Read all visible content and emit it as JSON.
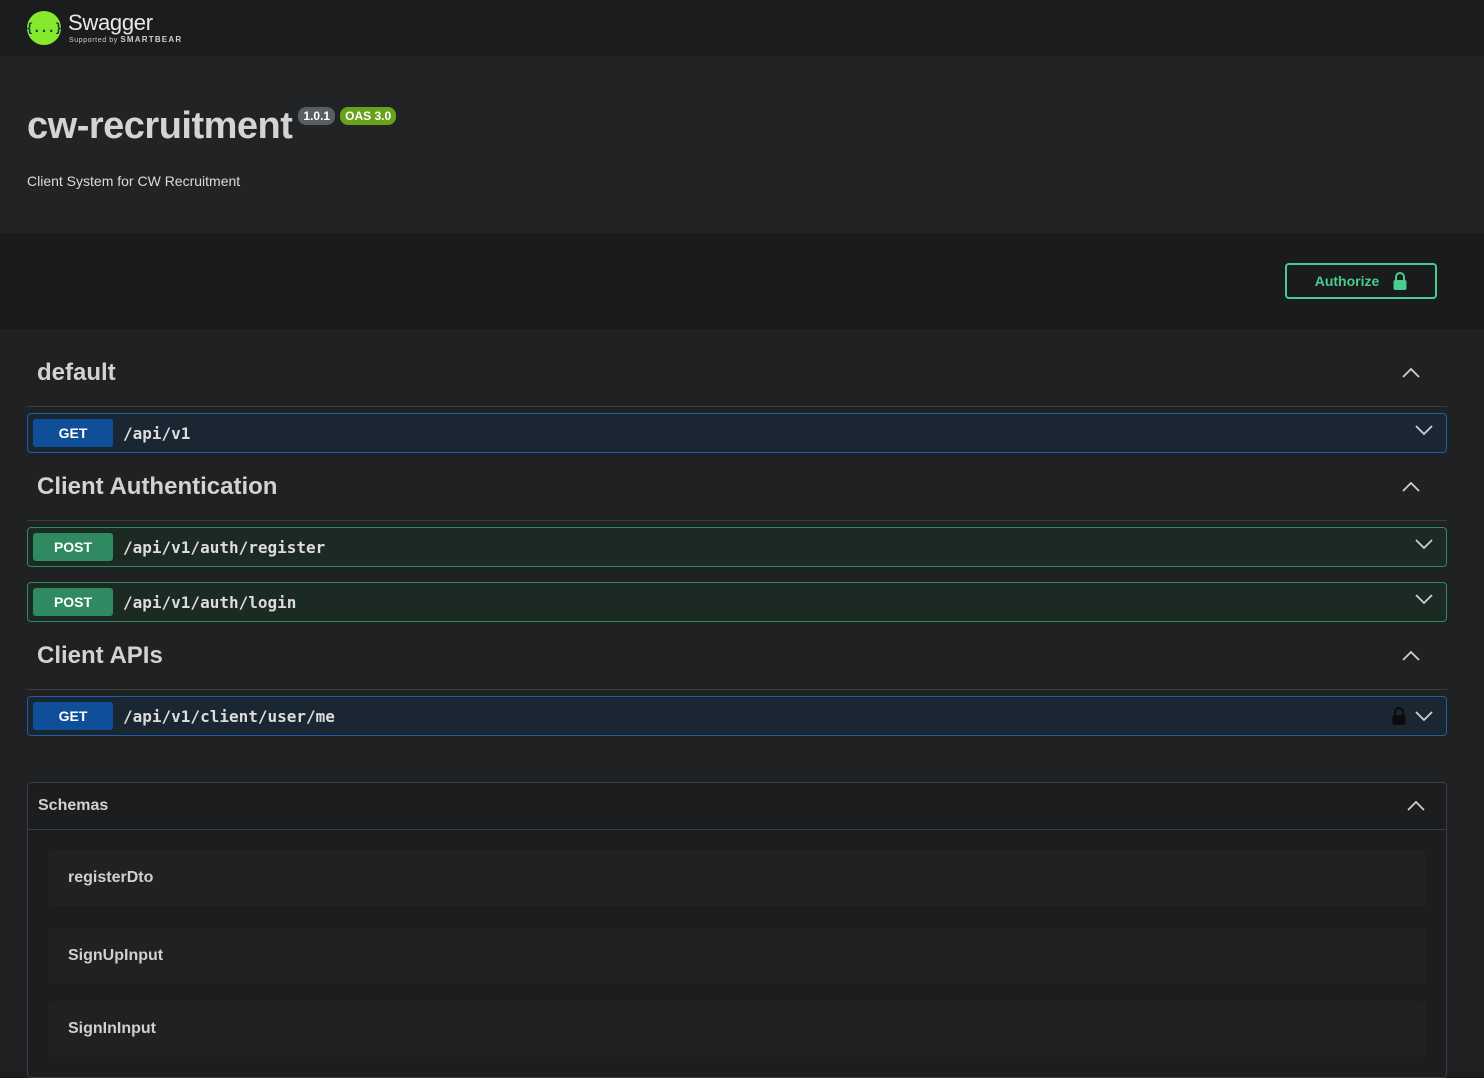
{
  "topbar": {
    "logo_name": "Swagger",
    "logo_sub_prefix": "Supported by",
    "logo_sub_brand": "SMARTBEAR",
    "logo_mark": "{...}"
  },
  "info": {
    "title": "cw-recruitment",
    "version": "1.0.1",
    "oas": "OAS 3.0",
    "description": "Client System for CW Recruitment"
  },
  "authorize": {
    "label": "Authorize",
    "icon": "lock-icon"
  },
  "tags": [
    {
      "name": "default",
      "operations": [
        {
          "method": "GET",
          "path": "/api/v1",
          "locked": false
        }
      ]
    },
    {
      "name": "Client Authentication",
      "operations": [
        {
          "method": "POST",
          "path": "/api/v1/auth/register",
          "locked": false
        },
        {
          "method": "POST",
          "path": "/api/v1/auth/login",
          "locked": false
        }
      ]
    },
    {
      "name": "Client APIs",
      "operations": [
        {
          "method": "GET",
          "path": "/api/v1/client/user/me",
          "locked": true
        }
      ]
    }
  ],
  "schemas": {
    "title": "Schemas",
    "items": [
      "registerDto",
      "SignUpInput",
      "SignInInput"
    ]
  },
  "colors": {
    "get": "#0f4f99",
    "post": "#2f8a62",
    "accent": "#49cc90",
    "logo": "#85ea2d"
  }
}
